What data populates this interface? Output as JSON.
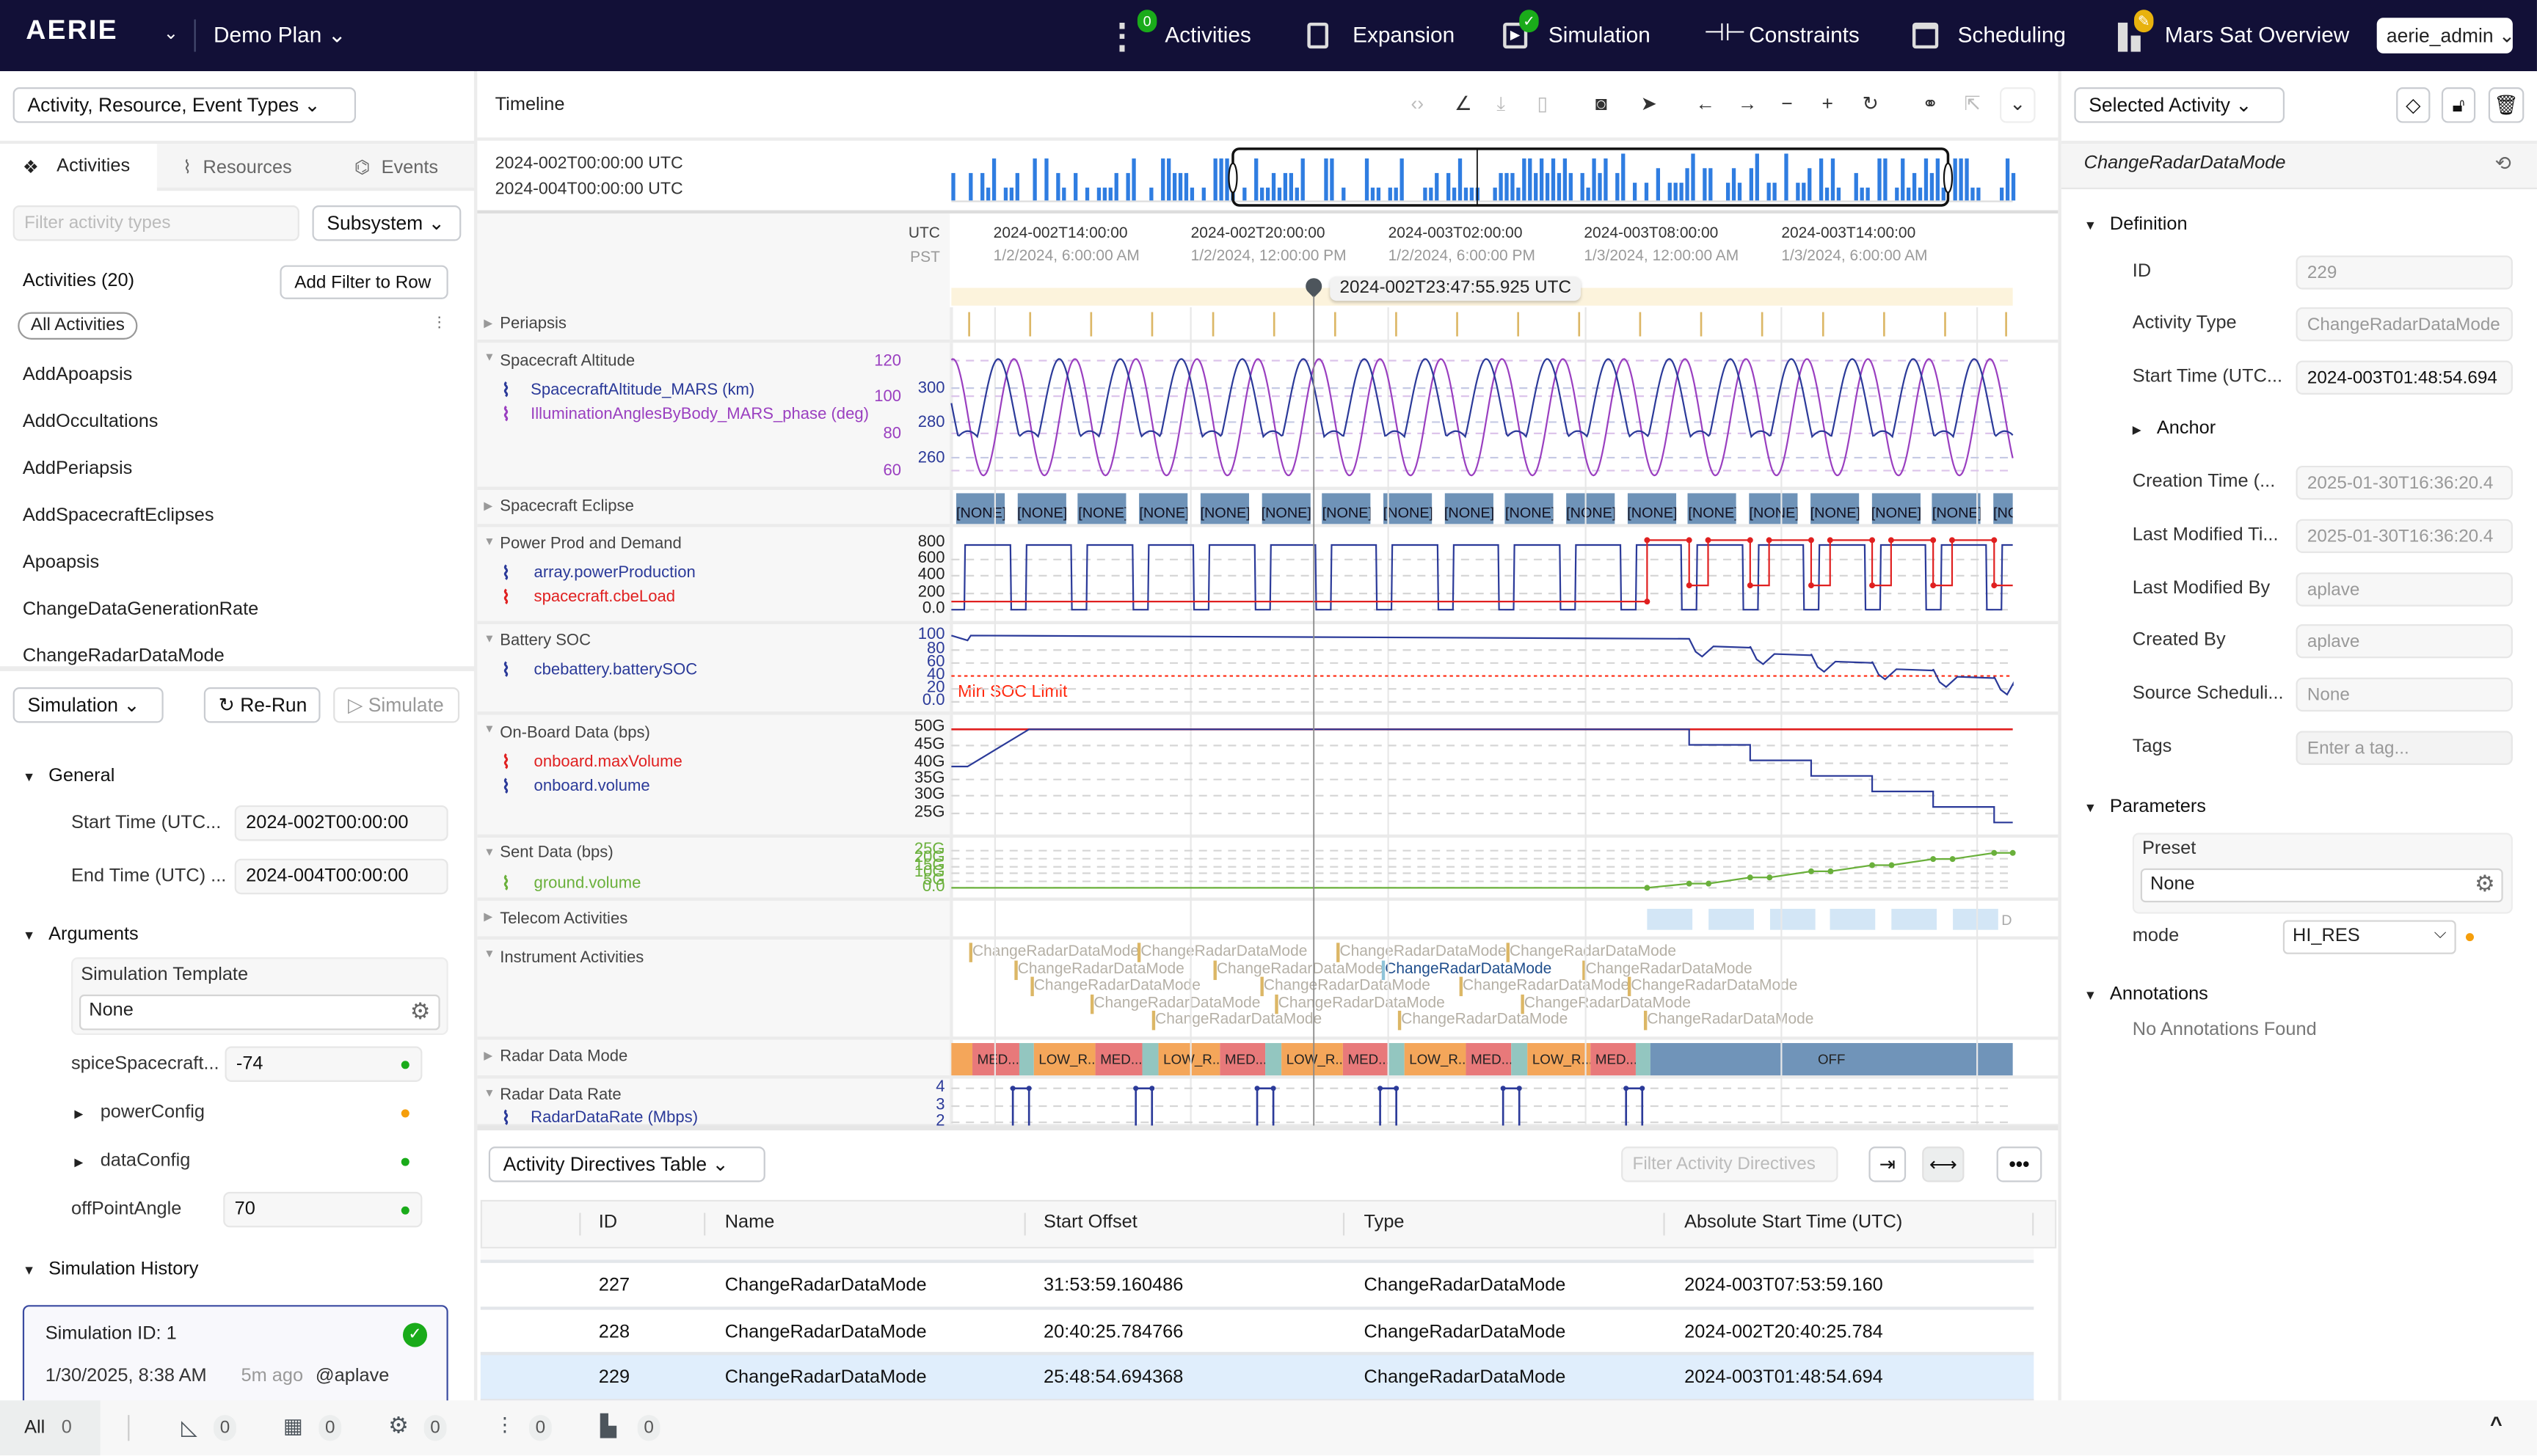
{
  "nav": {
    "logo": "AERIE",
    "plan": "Demo Plan",
    "items": [
      {
        "label": "Activities",
        "badge": "0",
        "icon": "activities-icon"
      },
      {
        "label": "Expansion",
        "icon": "expansion-icon"
      },
      {
        "label": "Simulation",
        "badge": "✓",
        "icon": "simulation-icon"
      },
      {
        "label": "Constraints",
        "icon": "constraints-icon"
      },
      {
        "label": "Scheduling",
        "icon": "scheduling-icon"
      },
      {
        "label": "Mars Sat Overview",
        "icon": "view-icon"
      }
    ],
    "user": "aerie_admin"
  },
  "left": {
    "types_dropdown": "Activity, Resource, Event Types",
    "tabs": [
      "Activities",
      "Resources",
      "Events"
    ],
    "filter_placeholder": "Filter activity types",
    "subsystem": "Subsystem",
    "activities_count": "Activities (20)",
    "add_filter": "Add Filter to Row",
    "all_activities": "All Activities",
    "activity_types": [
      "AddApoapsis",
      "AddOccultations",
      "AddPeriapsis",
      "AddSpacecraftEclipses",
      "Apoapsis",
      "ChangeDataGenerationRate",
      "ChangeRadarDataMode"
    ],
    "simulation_dropdown": "Simulation",
    "rerun": "Re-Run",
    "simulate": "Simulate",
    "general": "General",
    "start_label": "Start Time (UTC...",
    "start_value": "2024-002T00:00:00",
    "end_label": "End Time (UTC) ...",
    "end_value": "2024-004T00:00:00",
    "arguments": "Arguments",
    "sim_template_label": "Simulation Template",
    "sim_template_value": "None",
    "args": [
      {
        "name": "spiceSpacecraft...",
        "value": "-74",
        "status": "#1aab1a"
      },
      {
        "name": "powerConfig",
        "status": "#f59e0b"
      },
      {
        "name": "dataConfig",
        "status": "#1aab1a"
      },
      {
        "name": "offPointAngle",
        "value": "70",
        "status": "#1aab1a"
      }
    ],
    "history": "Simulation History",
    "sim_card": {
      "title": "Simulation ID: 1",
      "date": "1/30/2025, 8:38 AM",
      "ago": "5m ago",
      "user": "@aplave"
    }
  },
  "timeline": {
    "title": "Timeline",
    "range_start": "2024-002T00:00:00 UTC",
    "range_end": "2024-004T00:00:00 UTC",
    "tz_utc": "UTC",
    "tz_pst": "PST",
    "ticks_utc": [
      "2024-002T14:00:00",
      "2024-002T20:00:00",
      "2024-003T02:00:00",
      "2024-003T08:00:00",
      "2024-003T14:00:00"
    ],
    "ticks_pst": [
      "1/2/2024, 6:00:00 AM",
      "1/2/2024, 12:00:00 PM",
      "1/2/2024, 6:00:00 PM",
      "1/3/2024, 12:00:00 AM",
      "1/3/2024, 6:00:00 AM"
    ],
    "cursor_time": "2024-002T23:47:55.925 UTC",
    "rows": {
      "periapsis": "Periapsis",
      "altitude": {
        "title": "Spacecraft Altitude",
        "series": [
          "SpacecraftAltitude_MARS (km)",
          "IlluminationAnglesByBody_MARS_phase (deg)"
        ],
        "ticks_left": [
          "120",
          "100",
          "80",
          "60"
        ],
        "ticks_right": [
          "300",
          "280",
          "260"
        ],
        "colors": [
          "#2b3a99",
          "#9a3fc0"
        ]
      },
      "eclipse": {
        "title": "Spacecraft Eclipse",
        "label": "[NONE]"
      },
      "power": {
        "title": "Power Prod and Demand",
        "series": [
          "array.powerProduction",
          "spacecraft.cbeLoad"
        ],
        "ticks": [
          "800",
          "600",
          "400",
          "200",
          "0.0"
        ],
        "colors": [
          "#2b3a99",
          "#e02020"
        ]
      },
      "battery": {
        "title": "Battery SOC",
        "series": [
          "cbebattery.batterySOC"
        ],
        "ticks": [
          "100",
          "80",
          "60",
          "40",
          "20",
          "0.0"
        ],
        "limit_label": "Min SOC Limit",
        "colors": [
          "#2b3a99",
          "#ff2a10"
        ]
      },
      "onboard": {
        "title": "On-Board Data (bps)",
        "series": [
          "onboard.maxVolume",
          "onboard.volume"
        ],
        "ticks": [
          "50G",
          "45G",
          "40G",
          "35G",
          "30G",
          "25G"
        ],
        "colors": [
          "#e02020",
          "#2b3a99"
        ]
      },
      "sent": {
        "title": "Sent Data (bps)",
        "series": [
          "ground.volume"
        ],
        "ticks": [
          "25G",
          "20G",
          "15G",
          "10G",
          "5G",
          "0.0"
        ],
        "colors": [
          "#6ab03b"
        ]
      },
      "telecom": {
        "title": "Telecom Activities",
        "tail_label": "D"
      },
      "instrument": {
        "title": "Instrument Activities",
        "activities": [
          "ChangeRadarDataMode",
          "ChangeRadarDataMode",
          "ChangeRadarDataMode",
          "ChangeRadarDataMode",
          "ChangeRadarDataMode",
          "ChangeRadarDataMode",
          "ChangeRadarDataMode",
          "ChangeRadarDataMode",
          "ChangeRadarDataMode",
          "ChangeRadarDataMode",
          "ChangeRadarDataMode",
          "ChangeRadarDataMode",
          "ChangeRadarDataMode",
          "ChangeRadarDataMode",
          "ChangeRadarDataMode",
          "ChangeRadarDataMode",
          "ChangeRadarDataMode",
          "ChangeRadarDataMode"
        ]
      },
      "radar_mode": {
        "title": "Radar Data Mode",
        "modes": [
          "",
          "MED...",
          "",
          "LOW_R...",
          "MED...",
          "",
          "LOW_R...",
          "MED...",
          "",
          "LOW_R...",
          "MED...",
          "",
          "LOW_R...",
          "MED...",
          "",
          "LOW_R...",
          "MED...",
          "",
          "OFF"
        ],
        "colors": {
          "MED": "#e8797a",
          "LOW": "#f4a65a",
          "TRANS": "#93c6c0",
          "OFF": "#7094b9"
        }
      },
      "radar_rate": {
        "title": "Radar Data Rate",
        "series": [
          "RadarDataRate (Mbps)"
        ],
        "ticks": [
          "4",
          "3",
          "2"
        ]
      }
    }
  },
  "table": {
    "view": "Activity Directives Table",
    "filter_placeholder": "Filter Activity Directives",
    "columns": [
      "ID",
      "Name",
      "Start Offset",
      "Type",
      "Absolute Start Time (UTC)"
    ],
    "rows": [
      {
        "id": "227",
        "name": "ChangeRadarDataMode",
        "offset": "31:53:59.160486",
        "type": "ChangeRadarDataMode",
        "start": "2024-003T07:53:59.160"
      },
      {
        "id": "228",
        "name": "ChangeRadarDataMode",
        "offset": "20:40:25.784766",
        "type": "ChangeRadarDataMode",
        "start": "2024-002T20:40:25.784"
      },
      {
        "id": "229",
        "name": "ChangeRadarDataMode",
        "offset": "25:48:54.694368",
        "type": "ChangeRadarDataMode",
        "start": "2024-003T01:48:54.694",
        "selected": true
      }
    ]
  },
  "right": {
    "dropdown": "Selected Activity",
    "activity_name": "ChangeRadarDataMode",
    "definition": "Definition",
    "fields": [
      {
        "label": "ID",
        "value": "229"
      },
      {
        "label": "Activity Type",
        "value": "ChangeRadarDataMode"
      },
      {
        "label": "Start Time (UTC...",
        "value": "2024-003T01:48:54.694"
      },
      {
        "label": "Creation Time (...",
        "value": "2025-01-30T16:36:20.4"
      },
      {
        "label": "Last Modified Ti...",
        "value": "2025-01-30T16:36:20.4"
      },
      {
        "label": "Last Modified By",
        "value": "aplave"
      },
      {
        "label": "Created By",
        "value": "aplave"
      },
      {
        "label": "Source Scheduli...",
        "value": "None"
      },
      {
        "label": "Tags",
        "placeholder": "Enter a tag..."
      }
    ],
    "anchor": "Anchor",
    "parameters": "Parameters",
    "preset_label": "Preset",
    "preset_value": "None",
    "mode_label": "mode",
    "mode_value": "HI_RES",
    "annotations": "Annotations",
    "no_annotations": "No Annotations Found"
  },
  "statusbar": {
    "all_label": "All",
    "all_count": "0",
    "counts": [
      "0",
      "0",
      "0",
      "0",
      "0"
    ]
  }
}
